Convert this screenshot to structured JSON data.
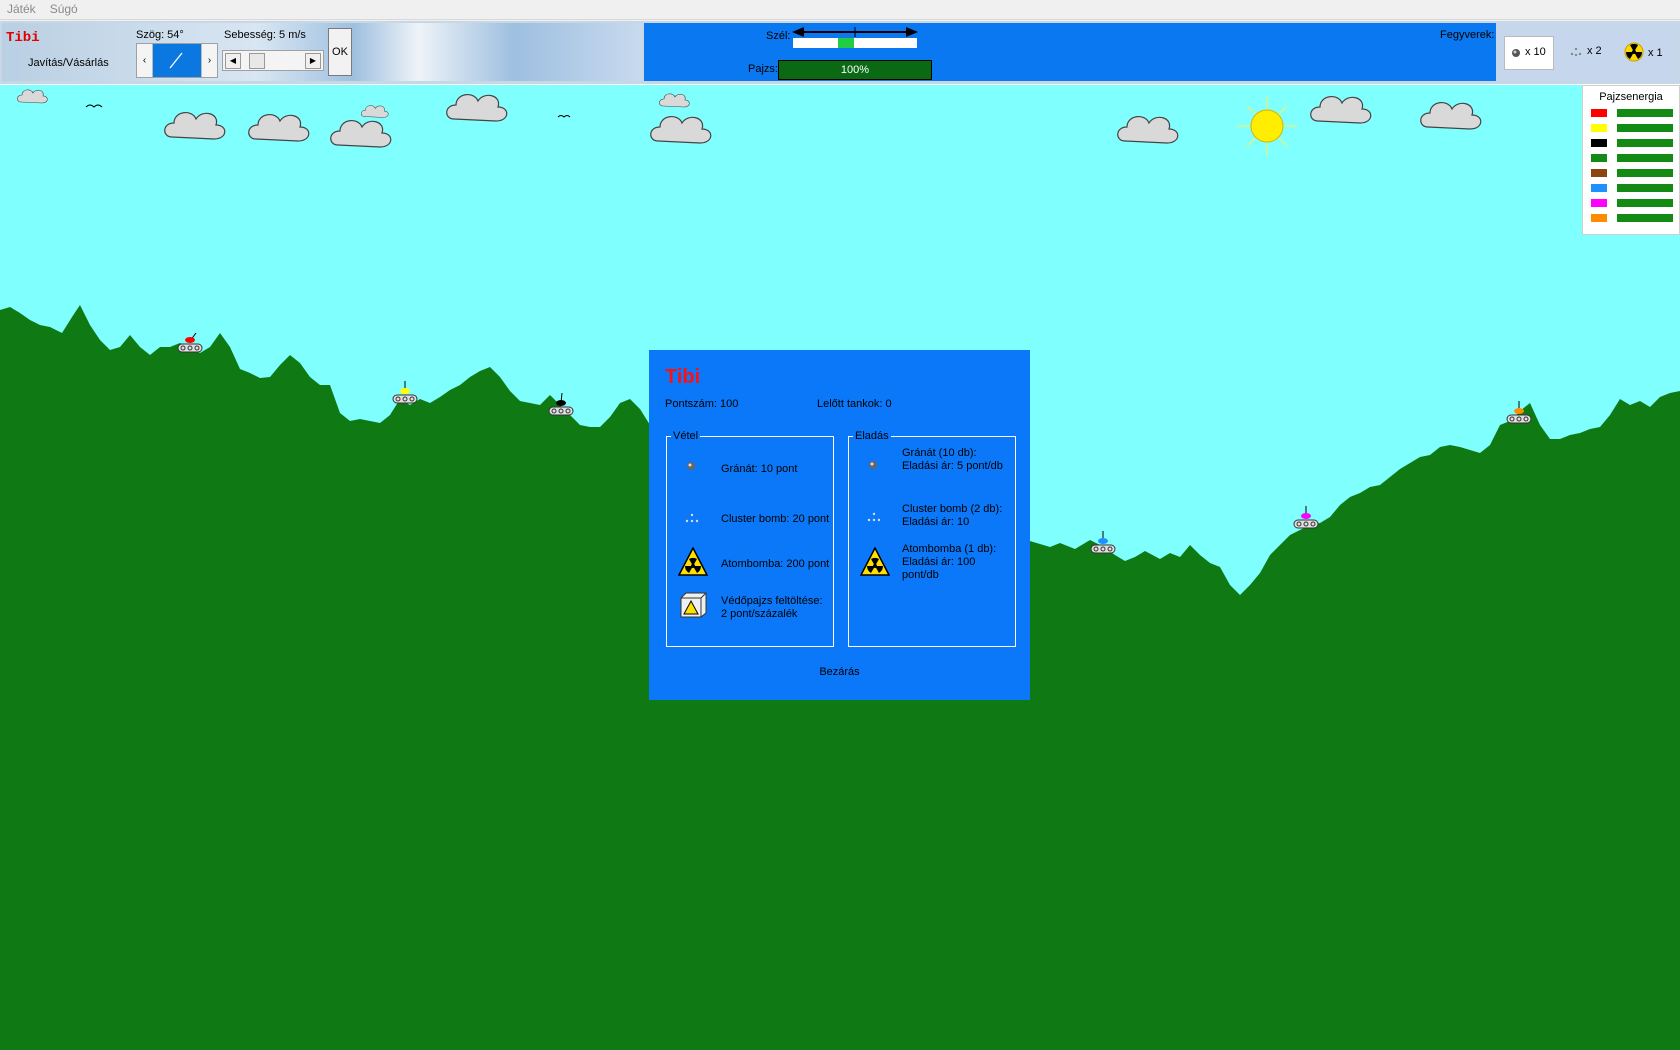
{
  "menu": {
    "items": [
      "Játék",
      "Súgó"
    ]
  },
  "toolbar": {
    "player_name": "Tibi",
    "repair_label": "Javítás/Vásárlás",
    "angle_label": "Szög: 54°",
    "speed_label": "Sebesség: 5 m/s",
    "ok_label": "OK",
    "wind_label": "Szél:",
    "shield_label": "Pajzs:",
    "shield_value": "100%",
    "weapons_label": "Fegyverek:",
    "weapons": [
      {
        "icon": "grenade-icon",
        "count": "x 10"
      },
      {
        "icon": "cluster-bomb-icon",
        "count": "x 2"
      },
      {
        "icon": "nuke-icon",
        "count": "x 1"
      }
    ]
  },
  "energy_panel": {
    "title": "Pajzsenergia",
    "players": [
      {
        "color": "#ff0000",
        "level": 1.0
      },
      {
        "color": "#ffff00",
        "level": 1.0
      },
      {
        "color": "#000000",
        "level": 1.0
      },
      {
        "color": "#138a13",
        "level": 1.0
      },
      {
        "color": "#8b4513",
        "level": 1.0
      },
      {
        "color": "#1e90ff",
        "level": 1.0
      },
      {
        "color": "#ff00ff",
        "level": 1.0
      },
      {
        "color": "#ff8c00",
        "level": 1.0
      }
    ]
  },
  "shop": {
    "player_name": "Tibi",
    "score": "Pontszám: 100",
    "kills": "Lelőtt tankok: 0",
    "buy_label": "Vétel",
    "sell_label": "Eladás",
    "buy_items": [
      {
        "icon": "grenade-icon",
        "lines": [
          "Gránát: 10 pont"
        ]
      },
      {
        "icon": "cluster-bomb-icon",
        "lines": [
          "Cluster bomb: 20 pont"
        ]
      },
      {
        "icon": "nuke-icon",
        "lines": [
          "Atombomba: 200 pont"
        ]
      },
      {
        "icon": "shield-recharge-icon",
        "lines": [
          "Védőpajzs feltöltése:",
          "2 pont/százalék"
        ]
      }
    ],
    "sell_items": [
      {
        "icon": "grenade-icon",
        "lines": [
          "Gránát (10 db):",
          "Eladási ár: 5 pont/db"
        ]
      },
      {
        "icon": "cluster-bomb-icon",
        "lines": [
          "Cluster bomb (2 db):",
          "Eladási ár: 10"
        ]
      },
      {
        "icon": "nuke-icon",
        "lines": [
          "Atombomba (1 db):",
          "Eladási ár: 100",
          "pont/db"
        ]
      }
    ],
    "close_label": "Bezárás"
  },
  "colors": {
    "sky": "#80ffff",
    "ground": "#0f7a14",
    "panel_blue": "#0a78f8"
  }
}
